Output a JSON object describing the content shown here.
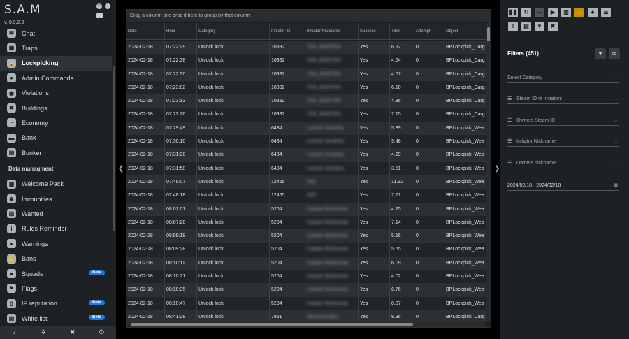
{
  "app": {
    "logo": "S.A.M",
    "version": "v. 0.9.2.3"
  },
  "sidebar": {
    "top_items": [
      {
        "label": "Chat",
        "icon": "chat-icon",
        "glyph": "✉"
      },
      {
        "label": "Traps",
        "icon": "trap-icon",
        "glyph": "▣"
      },
      {
        "label": "Lockpicking",
        "icon": "lock-icon",
        "glyph": "🔒",
        "active": true
      },
      {
        "label": "Admin Commands",
        "icon": "admin-commands-icon",
        "glyph": "●"
      },
      {
        "label": "Violations",
        "icon": "violations-icon",
        "glyph": "◉"
      },
      {
        "label": "Buildings",
        "icon": "buildings-icon",
        "glyph": "✖"
      },
      {
        "label": "Economy",
        "icon": "economy-icon",
        "glyph": "◔"
      },
      {
        "label": "Bank",
        "icon": "bank-icon",
        "glyph": "▬"
      },
      {
        "label": "Bunker",
        "icon": "bunker-icon",
        "glyph": "▤"
      }
    ],
    "section_label": "Data managment",
    "data_items": [
      {
        "label": "Welcome Pack",
        "icon": "welcome-pack-icon",
        "glyph": "▦"
      },
      {
        "label": "Immunities",
        "icon": "shield-icon",
        "glyph": "◈"
      },
      {
        "label": "Wanted",
        "icon": "wanted-icon",
        "glyph": "▥"
      },
      {
        "label": "Rules Reminder",
        "icon": "info-icon",
        "glyph": "i"
      },
      {
        "label": "Warnings",
        "icon": "warning-icon",
        "glyph": "▲"
      },
      {
        "label": "Bans",
        "icon": "ban-icon",
        "glyph": "✋"
      },
      {
        "label": "Squads",
        "icon": "squads-icon",
        "glyph": "●",
        "badge": "Beta"
      },
      {
        "label": "Flags",
        "icon": "flag-icon",
        "glyph": "⚑"
      },
      {
        "label": "IP reputation",
        "icon": "ip-reputation-icon",
        "glyph": "▯",
        "badge": "Beta"
      },
      {
        "label": "White list",
        "icon": "white-list-icon",
        "glyph": "▤",
        "badge": "Beta"
      }
    ]
  },
  "grid": {
    "group_hint": "Drag a column and drop it here to group by that column",
    "columns": [
      "Date",
      "Hour",
      "Category",
      "Initiator ID",
      "Initiator Nickname",
      "Success",
      "Time",
      "Attempt",
      "Object"
    ],
    "rows": [
      [
        "2024-02-18",
        "07:22:29",
        "Unlock lock",
        "10382",
        "THE_MOOTEH",
        "Yes",
        "6.92",
        "0",
        "BPLockpick_Carg"
      ],
      [
        "2024-02-18",
        "07:22:38",
        "Unlock lock",
        "10382",
        "THE_MOOTEH",
        "Yes",
        "4.64",
        "0",
        "BPLockpick_Carg"
      ],
      [
        "2024-02-18",
        "07:22:50",
        "Unlock lock",
        "10382",
        "THE_MOOTEH",
        "Yes",
        "4.57",
        "0",
        "BPLockpick_Carg"
      ],
      [
        "2024-02-18",
        "07:23:02",
        "Unlock lock",
        "10382",
        "THE_MOOTEH",
        "Yes",
        "6.10",
        "0",
        "BPLockpick_Carg"
      ],
      [
        "2024-02-18",
        "07:23:13",
        "Unlock lock",
        "10382",
        "THE_MOOTEH",
        "Yes",
        "4.86",
        "0",
        "BPLockpick_Carg"
      ],
      [
        "2024-02-18",
        "07:23:26",
        "Unlock lock",
        "10382",
        "THE_MOOTEH",
        "Yes",
        "7.15",
        "0",
        "BPLockpick_Carg"
      ],
      [
        "2024-02-18",
        "07:29:49",
        "Unlock lock",
        "6484",
        "Loeshe Vendetta",
        "Yes",
        "5.89",
        "0",
        "BPLockpick_Wea"
      ],
      [
        "2024-02-18",
        "07:30:10",
        "Unlock lock",
        "6484",
        "Loeshe Vendetta",
        "Yes",
        "9.48",
        "0",
        "BPLockpick_Wea"
      ],
      [
        "2024-02-18",
        "07:31:38",
        "Unlock lock",
        "6484",
        "Loeshe Vendetta",
        "Yes",
        "4.29",
        "0",
        "BPLockpick_Wea"
      ],
      [
        "2024-02-18",
        "07:31:58",
        "Unlock lock",
        "6484",
        "Loeshe Vendetta",
        "Yes",
        "3.51",
        "0",
        "BPLockpick_Wea"
      ],
      [
        "2024-02-18",
        "07:48:07",
        "Unlock lock",
        "12465",
        "Mell",
        "Yes",
        "11.32",
        "0",
        "BPLockpick_Wea"
      ],
      [
        "2024-02-18",
        "07:48:18",
        "Unlock lock",
        "12465",
        "Mell",
        "Yes",
        "7.71",
        "0",
        "BPLockpick_Wea"
      ],
      [
        "2024-02-18",
        "08:07:01",
        "Unlock lock",
        "5204",
        "Captain BarDoreas",
        "Yes",
        "4.75",
        "0",
        "BPLockpick_Wea"
      ],
      [
        "2024-02-18",
        "08:07:20",
        "Unlock lock",
        "5204",
        "Captain BarDoreas",
        "Yes",
        "7.14",
        "0",
        "BPLockpick_Wea"
      ],
      [
        "2024-02-18",
        "08:09:18",
        "Unlock lock",
        "5204",
        "Captain BarDoreas",
        "Yes",
        "5.16",
        "0",
        "BPLockpick_Wea"
      ],
      [
        "2024-02-18",
        "08:09:28",
        "Unlock lock",
        "5204",
        "Captain BarDoreas",
        "Yes",
        "5.65",
        "0",
        "BPLockpick_Wea"
      ],
      [
        "2024-02-18",
        "08:10:11",
        "Unlock lock",
        "5204",
        "Captain BarDoreas",
        "Yes",
        "6.09",
        "0",
        "BPLockpick_Wea"
      ],
      [
        "2024-02-18",
        "08:10:21",
        "Unlock lock",
        "5204",
        "Captain BarDoreas",
        "Yes",
        "4.02",
        "0",
        "BPLockpick_Wea"
      ],
      [
        "2024-02-18",
        "08:10:35",
        "Unlock lock",
        "5204",
        "Captain BarDoreas",
        "Yes",
        "6.76",
        "0",
        "BPLockpick_Wea"
      ],
      [
        "2024-02-18",
        "08:10:47",
        "Unlock lock",
        "5204",
        "Captain BarDoreas",
        "Yes",
        "8.87",
        "0",
        "BPLockpick_Wea"
      ],
      [
        "2024-02-18",
        "08:41:28",
        "Unlock lock",
        "7851",
        "Melonpumpkin",
        "Yes",
        "8.96",
        "0",
        "BPLockpick_Carg"
      ]
    ]
  },
  "filters": {
    "title": "Filters (451)",
    "select_category": "Select Category",
    "steam_id_initiators": "Steam ID of initiators",
    "owners_steam_id": "Owners Steam ID",
    "initiator_nickname": "Initiator Nickname",
    "owners_nickname": "Owners nickname",
    "date_range": "2024/02/18 - 2024/02/18"
  }
}
